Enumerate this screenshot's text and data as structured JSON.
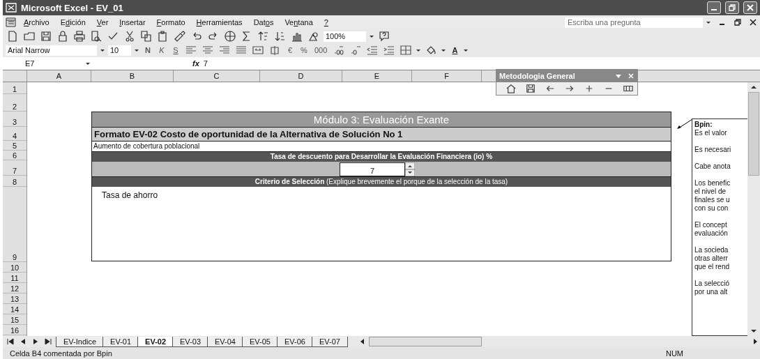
{
  "window": {
    "title": "Microsoft Excel - EV_01"
  },
  "menu": [
    {
      "label": "Archivo"
    },
    {
      "label": "Edición"
    },
    {
      "label": "Ver"
    },
    {
      "label": "Insertar"
    },
    {
      "label": "Formato"
    },
    {
      "label": "Herramientas"
    },
    {
      "label": "Datos"
    },
    {
      "label": "Ventana"
    },
    {
      "label": "?"
    }
  ],
  "help_search": {
    "placeholder": "Escriba una pregunta"
  },
  "standard_toolbar": {
    "zoom": "100%"
  },
  "format_toolbar": {
    "font": "Arial Narrow",
    "size": "10",
    "style_buttons": [
      "N",
      "K",
      "S"
    ],
    "number_buttons": [
      "€",
      "%",
      "000"
    ],
    "font_color": "A"
  },
  "formula_bar": {
    "cell": "E7",
    "function_label": "fx",
    "value": "7"
  },
  "columns": [
    "A",
    "B",
    "C",
    "D",
    "E",
    "F"
  ],
  "rows": [
    "1",
    "2",
    "3",
    "4",
    "5",
    "6",
    "7",
    "8",
    "9",
    "10",
    "11",
    "12",
    "13",
    "14",
    "15",
    "16"
  ],
  "floating_toolbar": {
    "title": "Metodologia General"
  },
  "form": {
    "title": "Módulo 3: Evaluación Exante",
    "subtitle": "Formato EV-02 Costo de oportunidad de la Alternativa de Solución No 1",
    "alternative": "Aumento de cobertura poblacional",
    "rate_header": "Tasa de descuento para Desarrollar la Evaluación Financiera (io) %",
    "rate_value": "7",
    "criterion_header": "**Criterio de Selección** (Explique brevemente el porque de la selección de la tasa)",
    "criterion_text": "Tasa de ahorro"
  },
  "comment": {
    "author": "Bpin:",
    "paragraphs": [
      "Es el valor",
      "Es necesari",
      "Cabe anota",
      "Los benefic\nel nivel de\nfinales se u\ncon su con",
      "El concept\nevaluación",
      "La socieda\notras alterr\nque el rend",
      "La selecció\npor una alt"
    ]
  },
  "sheet_tabs": [
    {
      "label": "EV-Indice",
      "selected": false
    },
    {
      "label": "EV-01",
      "selected": false
    },
    {
      "label": "EV-02",
      "selected": true
    },
    {
      "label": "EV-03",
      "selected": false
    },
    {
      "label": "EV-04",
      "selected": false
    },
    {
      "label": "EV-05",
      "selected": false
    },
    {
      "label": "EV-06",
      "selected": false
    },
    {
      "label": "EV-07",
      "selected": false
    }
  ],
  "status_bar": {
    "message": "Celda B4 comentada por Bpin",
    "indicator": "NUM"
  }
}
